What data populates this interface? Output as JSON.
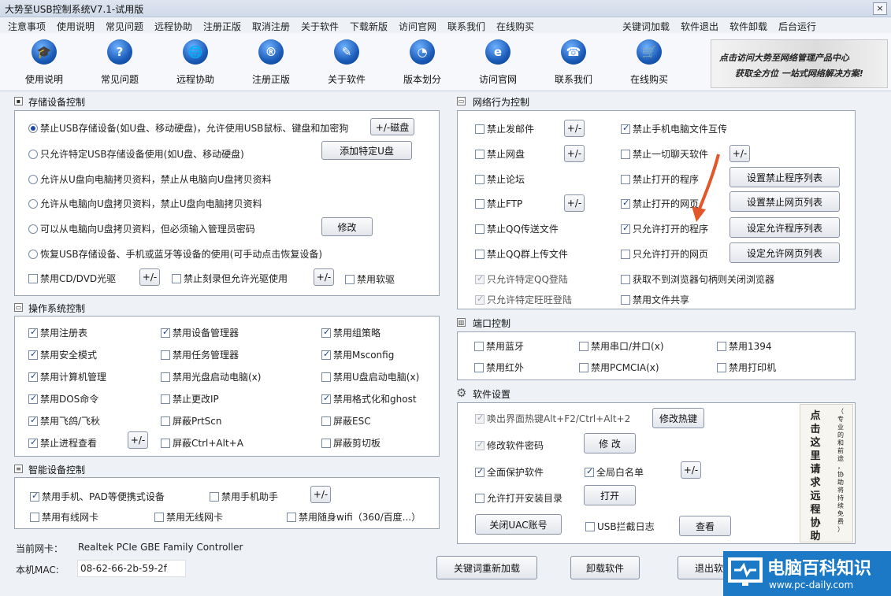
{
  "window": {
    "title": "大势至USB控制系统V7.1-试用版",
    "close_glyph": "×"
  },
  "menu": {
    "left": [
      "注意事项",
      "使用说明",
      "常见问题",
      "远程协助",
      "注册正版",
      "取消注册",
      "关于软件",
      "下载新版",
      "访问官网",
      "联系我们",
      "在线购买"
    ],
    "right": [
      "关键词加载",
      "软件退出",
      "软件卸载",
      "后台运行"
    ]
  },
  "toolbar": {
    "buttons": [
      {
        "label": "使用说明",
        "icon": "graduation-cap-icon",
        "glyph": "🎓"
      },
      {
        "label": "常见问题",
        "icon": "question-icon",
        "glyph": "?"
      },
      {
        "label": "远程协助",
        "icon": "globe-icon",
        "glyph": "🌐"
      },
      {
        "label": "注册正版",
        "icon": "registered-icon",
        "glyph": "®"
      },
      {
        "label": "关于软件",
        "icon": "document-pen-icon",
        "glyph": "✎"
      },
      {
        "label": "版本划分",
        "icon": "pie-chart-icon",
        "glyph": "◔"
      },
      {
        "label": "访问官网",
        "icon": "browser-icon",
        "glyph": "e"
      },
      {
        "label": "联系我们",
        "icon": "phone-icon",
        "glyph": "☎"
      },
      {
        "label": "在线购买",
        "icon": "cart-icon",
        "glyph": "🛒"
      }
    ]
  },
  "banner": {
    "line1": "点击访问大势至网络管理产品中心",
    "line2": "获取全方位 一站式网络解决方案!"
  },
  "storage": {
    "title": "存储设备控制",
    "radios": [
      {
        "label": "禁止USB存储设备(如U盘、移动硬盘)，允许使用USB鼠标、键盘和加密狗",
        "checked": true
      },
      {
        "label": "只允许特定USB存储设备使用(如U盘、移动硬盘)",
        "checked": false
      },
      {
        "label": "允许从U盘向电脑拷贝资料，禁止从电脑向U盘拷贝资料",
        "checked": false
      },
      {
        "label": "允许从电脑向U盘拷贝资料，禁止U盘向电脑拷贝资料",
        "checked": false
      },
      {
        "label": "可以从电脑向U盘拷贝资料，但必须输入管理员密码",
        "checked": false
      },
      {
        "label": "恢复USB存储设备、手机或蓝牙等设备的使用(可手动点击恢复设备)",
        "checked": false
      }
    ],
    "btn_disk": "+/-磁盘",
    "btn_add_u": "添加特定U盘",
    "btn_modify": "修改",
    "cd_label": "禁用CD/DVD光驱",
    "burn_label": "禁止刻录但允许光驱使用",
    "floppy_label": "禁用软驱",
    "plusminus": "+/-"
  },
  "os": {
    "title": "操作系统控制",
    "items": [
      {
        "label": "禁用注册表",
        "checked": true
      },
      {
        "label": "禁用设备管理器",
        "checked": true
      },
      {
        "label": "禁用组策略",
        "checked": true
      },
      {
        "label": "禁用安全模式",
        "checked": true
      },
      {
        "label": "禁用任务管理器",
        "checked": false
      },
      {
        "label": "禁用Msconfig",
        "checked": true
      },
      {
        "label": "禁用计算机管理",
        "checked": true
      },
      {
        "label": "禁用光盘启动电脑(x)",
        "checked": false
      },
      {
        "label": "禁用U盘启动电脑(x)",
        "checked": false
      },
      {
        "label": "禁用DOS命令",
        "checked": true
      },
      {
        "label": "禁止更改IP",
        "checked": false
      },
      {
        "label": "禁用格式化和ghost",
        "checked": true
      },
      {
        "label": "禁用飞鸽/飞秋",
        "checked": true
      },
      {
        "label": "屏蔽PrtScn",
        "checked": false
      },
      {
        "label": "屏蔽ESC",
        "checked": false
      },
      {
        "label": "禁止进程查看",
        "checked": true
      },
      {
        "label": "屏蔽Ctrl+Alt+A",
        "checked": false
      },
      {
        "label": "屏蔽剪切板",
        "checked": false
      }
    ],
    "plusminus": "+/-"
  },
  "smart": {
    "title": "智能设备控制",
    "items": [
      {
        "label": "禁用手机、PAD等便携式设备",
        "checked": true
      },
      {
        "label": "禁用手机助手",
        "checked": false
      },
      {
        "label": "禁用有线网卡",
        "checked": false
      },
      {
        "label": "禁用无线网卡",
        "checked": false
      },
      {
        "label": "禁用随身wifi（360/百度...）",
        "checked": false
      }
    ],
    "plusminus": "+/-"
  },
  "footer": {
    "nic_label": "当前网卡：",
    "nic_value": "Realtek PCIe GBE Family Controller",
    "mac_label": "本机MAC:",
    "mac_value": "08-62-66-2b-59-2f",
    "btn_reload": "关键词重新加载",
    "btn_uninstall": "卸载软件",
    "btn_exit": "退出软件"
  },
  "network": {
    "title": "网络行为控制",
    "left": [
      {
        "label": "禁止发邮件",
        "checked": false
      },
      {
        "label": "禁止网盘",
        "checked": false
      },
      {
        "label": "禁止论坛",
        "checked": false
      },
      {
        "label": "禁止FTP",
        "checked": false
      },
      {
        "label": "禁止QQ传送文件",
        "checked": false
      },
      {
        "label": "禁止QQ群上传文件",
        "checked": false
      },
      {
        "label": "只允许特定QQ登陆",
        "checked": true
      },
      {
        "label": "只允许特定旺旺登陆",
        "checked": true
      }
    ],
    "right": [
      {
        "label": "禁止手机电脑文件互传",
        "checked": true
      },
      {
        "label": "禁止一切聊天软件",
        "checked": false
      },
      {
        "label": "禁止打开的程序",
        "checked": false
      },
      {
        "label": "禁止打开的网页",
        "checked": true
      },
      {
        "label": "只允许打开的程序",
        "checked": true
      },
      {
        "label": "只允许打开的网页",
        "checked": false
      },
      {
        "label": "获取不到浏览器句柄则关闭浏览器",
        "checked": false
      },
      {
        "label": "禁用文件共享",
        "checked": false
      }
    ],
    "btns": [
      "设置禁止程序列表",
      "设置禁止网页列表",
      "设定允许程序列表",
      "设定允许网页列表"
    ],
    "plusminus": "+/-"
  },
  "port": {
    "title": "端口控制",
    "items": [
      {
        "label": "禁用蓝牙",
        "checked": false
      },
      {
        "label": "禁用串口/并口(x)",
        "checked": false
      },
      {
        "label": "禁用1394",
        "checked": false
      },
      {
        "label": "禁用红外",
        "checked": false
      },
      {
        "label": "禁用PCMCIA(x)",
        "checked": false
      },
      {
        "label": "禁用打印机",
        "checked": false
      }
    ]
  },
  "software": {
    "title": "软件设置",
    "hotkey_label": "唤出界面热键Alt+F2/Ctrl+Alt+2",
    "hotkey_btn": "修改热键",
    "pwd_label": "修改软件密码",
    "pwd_btn": "修 改",
    "fullprotect_label": "全面保护软件",
    "whitelist_label": "全局白名单",
    "plusminus": "+/-",
    "installdir_label": "允许打开安装目录",
    "open_btn": "打开",
    "uac_btn": "关闭UAC账号",
    "usblog_label": "USB拦截日志",
    "view_btn": "查看",
    "scroll_col1": "点击这里请求远程协助",
    "scroll_col2": "（专业的和前途，协助将持续免费）"
  },
  "watermark": {
    "title": "电脑百科知识",
    "url": "www.pc-daily.com"
  },
  "colors": {
    "accent": "#1d49a3",
    "arrow": "#e2562a",
    "watermark_bg": "#1c79c6"
  }
}
